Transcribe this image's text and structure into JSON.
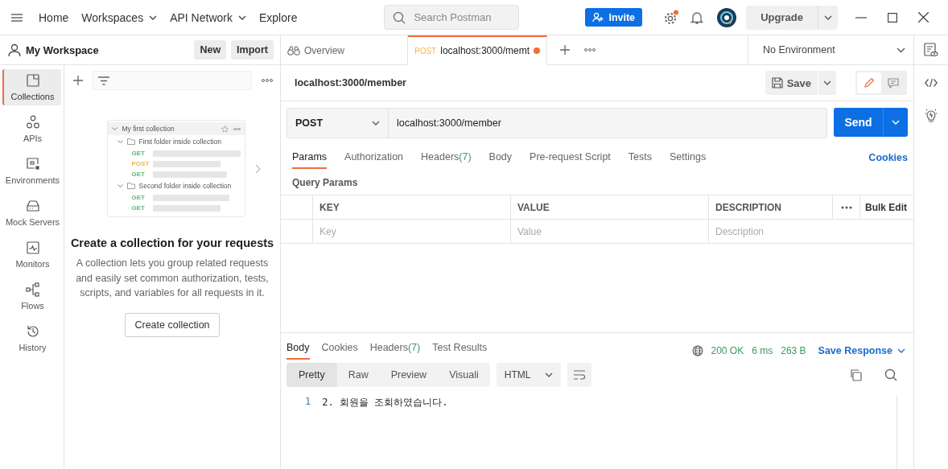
{
  "topbar": {
    "nav": [
      {
        "label": "Home",
        "dropdown": false
      },
      {
        "label": "Workspaces",
        "dropdown": true
      },
      {
        "label": "API Network",
        "dropdown": true
      },
      {
        "label": "Explore",
        "dropdown": false
      }
    ],
    "search": {
      "placeholder": "Search Postman"
    },
    "invite": "Invite",
    "settings_badge": true,
    "upgrade": "Upgrade"
  },
  "workspace": {
    "name": "My Workspace",
    "buttons": [
      "New",
      "Import"
    ]
  },
  "sidebar": {
    "items": [
      {
        "kind": "collections",
        "label": "Collections",
        "selected": true
      },
      {
        "kind": "apis",
        "label": "APIs",
        "selected": false
      },
      {
        "kind": "environments",
        "label": "Environments",
        "selected": false
      },
      {
        "kind": "mock",
        "label": "Mock Servers",
        "selected": false
      },
      {
        "kind": "monitors",
        "label": "Monitors",
        "selected": false
      },
      {
        "kind": "flows",
        "label": "Flows",
        "selected": false
      },
      {
        "kind": "history",
        "label": "History",
        "selected": false
      }
    ]
  },
  "collections_panel": {
    "illustration": {
      "collection": "My first collection",
      "folders": [
        {
          "name": "First folder inside collection",
          "requests": [
            {
              "method": "GET",
              "color": "#5fb87a"
            },
            {
              "method": "POST",
              "color": "#f0b44c"
            },
            {
              "method": "GET",
              "color": "#5fb87a"
            }
          ]
        },
        {
          "name": "Second folder inside collection",
          "requests": [
            {
              "method": "GET",
              "color": "#5fb87a"
            },
            {
              "method": "GET",
              "color": "#5fb87a"
            }
          ]
        }
      ]
    },
    "title": "Create a collection for your requests",
    "description": "A collection lets you group related requests and easily set common authorization, tests, scripts, and variables for all requests in it.",
    "button": "Create collection"
  },
  "tabs": [
    {
      "kind": "overview",
      "label": "Overview",
      "selected": false,
      "unsaved": false
    },
    {
      "kind": "request",
      "method": "POST",
      "label": "localhost:3000/memt",
      "selected": true,
      "unsaved": true
    }
  ],
  "environment": "No Environment",
  "request": {
    "name": "localhost:3000/member",
    "save": "Save",
    "method": "POST",
    "url": "localhost:3000/member",
    "send": "Send",
    "tabs": [
      {
        "label": "Params",
        "selected": true
      },
      {
        "label": "Authorization",
        "selected": false
      },
      {
        "label": "Headers",
        "count": "(7)",
        "selected": false
      },
      {
        "label": "Body",
        "selected": false
      },
      {
        "label": "Pre-request Script",
        "selected": false
      },
      {
        "label": "Tests",
        "selected": false
      },
      {
        "label": "Settings",
        "selected": false
      }
    ],
    "cookies": "Cookies",
    "query_title": "Query Params",
    "table": {
      "columns": [
        "KEY",
        "VALUE",
        "DESCRIPTION"
      ],
      "bulk_edit": "Bulk Edit",
      "placeholders": [
        "Key",
        "Value",
        "Description"
      ]
    }
  },
  "response": {
    "tabs": [
      {
        "label": "Body",
        "selected": true
      },
      {
        "label": "Cookies",
        "selected": false
      },
      {
        "label": "Headers",
        "count": "(7)",
        "selected": false
      },
      {
        "label": "Test Results",
        "selected": false
      }
    ],
    "status": "200 OK",
    "time": "6 ms",
    "size": "263 B",
    "save": "Save Response",
    "views": [
      {
        "label": "Pretty",
        "selected": true
      },
      {
        "label": "Raw",
        "selected": false
      },
      {
        "label": "Preview",
        "selected": false
      },
      {
        "label": "Visuali",
        "selected": false
      }
    ],
    "format": "HTML",
    "lines": [
      {
        "number": "1",
        "text": "2. 회원을 조회하였습니다."
      }
    ]
  }
}
